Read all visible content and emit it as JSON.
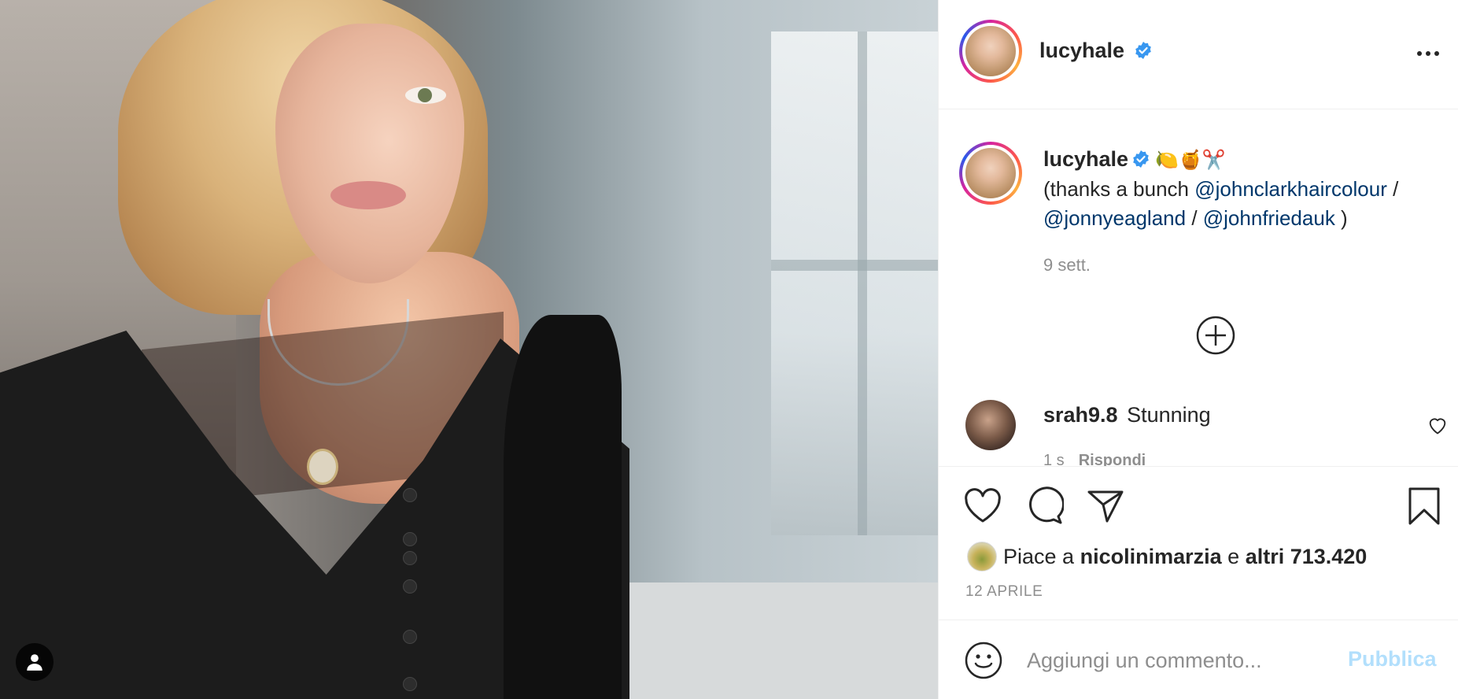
{
  "post": {
    "author": "lucyhale",
    "verified": true,
    "caption_emojis": "🍋🍯✂️",
    "caption_prefix": "(thanks a bunch ",
    "mentions": [
      "@johnclarkhaircolour",
      "@jonnyeagland",
      "@johnfriedauk"
    ],
    "caption_sep1": " / ",
    "caption_sep2": " / ",
    "caption_suffix": " )",
    "caption_time": "9 sett.",
    "date": "12 APRILE"
  },
  "comments": [
    {
      "username": "srah9.8",
      "text": "Stunning",
      "time": "1 s",
      "reply_label": "Rispondi"
    }
  ],
  "likes": {
    "prefix": "Piace a",
    "user": "nicolinimarzia",
    "connector": "e",
    "others": "altri 713.420"
  },
  "comment_box": {
    "placeholder": "Aggiungi un commento...",
    "publish_label": "Pubblica"
  },
  "icons": {
    "verified": "verified-badge-icon",
    "more": "more-options-icon",
    "load_more": "plus-circle-icon",
    "like": "heart-icon",
    "comment": "comment-bubble-icon",
    "share": "paper-plane-icon",
    "save": "bookmark-icon",
    "emoji": "smiley-icon",
    "user_tag": "user-silhouette-icon"
  },
  "colors": {
    "link": "#00376b",
    "verified": "#3897f0",
    "secondary_text": "#8e8e8e",
    "publish_disabled": "#b2dffc",
    "divider": "#efefef"
  }
}
